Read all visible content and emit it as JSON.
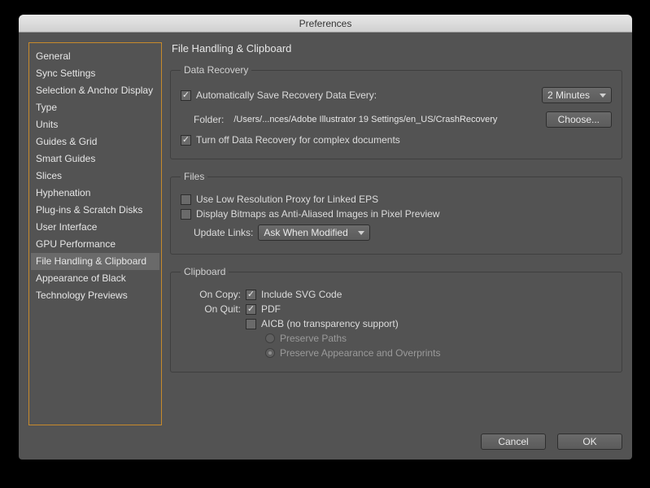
{
  "window": {
    "title": "Preferences"
  },
  "sidebar": {
    "items": [
      {
        "label": "General"
      },
      {
        "label": "Sync Settings"
      },
      {
        "label": "Selection & Anchor Display"
      },
      {
        "label": "Type"
      },
      {
        "label": "Units"
      },
      {
        "label": "Guides & Grid"
      },
      {
        "label": "Smart Guides"
      },
      {
        "label": "Slices"
      },
      {
        "label": "Hyphenation"
      },
      {
        "label": "Plug-ins & Scratch Disks"
      },
      {
        "label": "User Interface"
      },
      {
        "label": "GPU Performance"
      },
      {
        "label": "File Handling & Clipboard"
      },
      {
        "label": "Appearance of Black"
      },
      {
        "label": "Technology Previews"
      }
    ],
    "selected_index": 12
  },
  "page": {
    "title": "File Handling & Clipboard"
  },
  "data_recovery": {
    "legend": "Data Recovery",
    "auto_save_label": "Automatically Save Recovery Data Every:",
    "auto_save_checked": true,
    "interval_value": "2 Minutes",
    "folder_label": "Folder:",
    "folder_path": "/Users/...nces/Adobe Illustrator 19 Settings/en_US/CrashRecovery",
    "choose_label": "Choose...",
    "turn_off_label": "Turn off Data Recovery for complex documents",
    "turn_off_checked": true
  },
  "files": {
    "legend": "Files",
    "low_res_label": "Use Low Resolution Proxy for Linked EPS",
    "low_res_checked": false,
    "bitmaps_label": "Display Bitmaps as Anti-Aliased Images in Pixel Preview",
    "bitmaps_checked": false,
    "update_links_label": "Update Links:",
    "update_links_value": "Ask When Modified"
  },
  "clipboard": {
    "legend": "Clipboard",
    "on_copy_label": "On Copy:",
    "svg_label": "Include SVG Code",
    "svg_checked": true,
    "on_quit_label": "On Quit:",
    "pdf_label": "PDF",
    "pdf_checked": true,
    "aicb_label": "AICB (no transparency support)",
    "aicb_checked": false,
    "preserve_paths_label": "Preserve Paths",
    "preserve_appearance_label": "Preserve Appearance and Overprints",
    "radio_selected": "appearance"
  },
  "buttons": {
    "cancel": "Cancel",
    "ok": "OK"
  }
}
